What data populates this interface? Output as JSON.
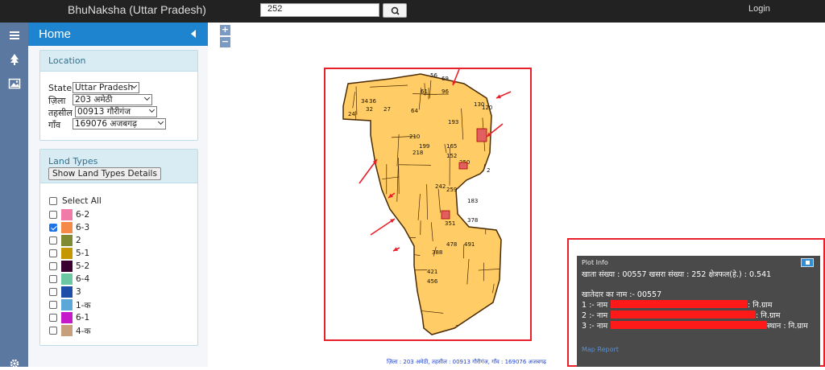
{
  "header": {
    "app_title": "BhuNaksha (Uttar Pradesh)",
    "search_value": "252",
    "search_icon": "search-icon",
    "login_label": "Login",
    "bg_color": "#222222"
  },
  "iconbar": {
    "icons": [
      "menu-icon",
      "tree-icon",
      "image-icon",
      "gear-icon"
    ]
  },
  "sidebar": {
    "title": "Home",
    "accent_color": "#1e84cf",
    "location": {
      "heading": "Location",
      "state_label": "State",
      "state_value": "Uttar Pradesh",
      "district_label": "ज़िला",
      "district_value": "203 अमेठी",
      "tehsil_label": "तहसील",
      "tehsil_value": "00913 गौरीगंज",
      "village_label": "गाँव",
      "village_value": "169076 अजबगढ़"
    },
    "land_types": {
      "heading": "Land Types",
      "details_button": "Show Land Types Details",
      "select_all": "Select All",
      "items": [
        {
          "label": "6-2",
          "color": "#f07aa8",
          "checked": false
        },
        {
          "label": "6-3",
          "color": "#f58a48",
          "checked": true
        },
        {
          "label": "2",
          "color": "#7f8a32",
          "checked": false
        },
        {
          "label": "5-1",
          "color": "#c49600",
          "checked": false
        },
        {
          "label": "5-2",
          "color": "#3a0030",
          "checked": false
        },
        {
          "label": "6-4",
          "color": "#6ac9a2",
          "checked": false
        },
        {
          "label": "3",
          "color": "#1f4ea8",
          "checked": false
        },
        {
          "label": "1-क",
          "color": "#5aa7d8",
          "checked": false
        },
        {
          "label": "6-1",
          "color": "#c41ac9",
          "checked": false
        },
        {
          "label": "4-क",
          "color": "#c6a07c",
          "checked": false
        }
      ]
    }
  },
  "map": {
    "zoom_in": "+",
    "zoom_out": "−",
    "parcel_color": "#ffcc66",
    "highlight_color": "#e8202a",
    "parcel_labels": [
      "56",
      "69",
      "61",
      "96",
      "34",
      "36",
      "24",
      "32",
      "27",
      "64",
      "210",
      "199",
      "165",
      "218",
      "250",
      "242",
      "259",
      "351",
      "378",
      "478",
      "491",
      "388",
      "421",
      "456",
      "183",
      "193",
      "130",
      "120",
      "152",
      "2"
    ],
    "caption": "ज़िला : 203 अमेठी, तहसील : 00913 गौरीगंज, गाँव : 169076 अजबगढ़"
  },
  "plot_info": {
    "title": "Plot Info",
    "summary": "खाता संख्या : 00557 खसरा संख्या : 252 क्षेत्रफल(हे.) : 0.541",
    "owner_heading": "खातेदार का नाम :- 00557",
    "owner_1_prefix": "1 :- नाम :",
    "owner_1_suffix": ": नि.ग्राम",
    "owner_2_prefix": "2 :- नाम :",
    "owner_2_suffix": ": नि.ग्राम",
    "owner_3_prefix": "3 :- नाम :",
    "owner_3_suffix": "स्थान : नि.ग्राम",
    "map_report_label": "Map Report",
    "bg_color": "#4a4a4a"
  }
}
